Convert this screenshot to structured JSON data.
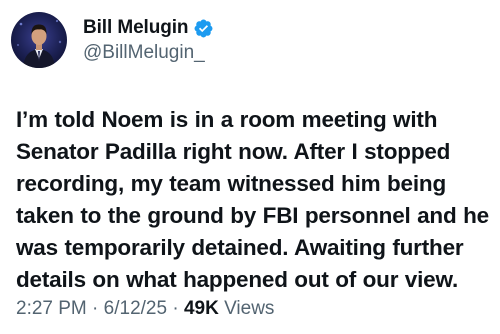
{
  "author": {
    "display_name": "Bill Melugin",
    "handle": "@BillMelugin_",
    "verified": true
  },
  "tweet": {
    "text": "I’m told Noem is in a room meeting with Senator Padilla right now. After I stopped recording, my team witnessed him being taken to the ground by FBI personnel and he was temporarily detained. Awaiting further details on what happened out of our view."
  },
  "meta": {
    "time": "2:27 PM",
    "separator": "·",
    "date": "6/12/25",
    "views_count": "49K",
    "views_label": "Views"
  },
  "colors": {
    "text": "#0f1419",
    "secondary": "#536471",
    "verified_badge": "#1d9bf0"
  },
  "icons": {
    "verified": "verified-badge-icon"
  }
}
